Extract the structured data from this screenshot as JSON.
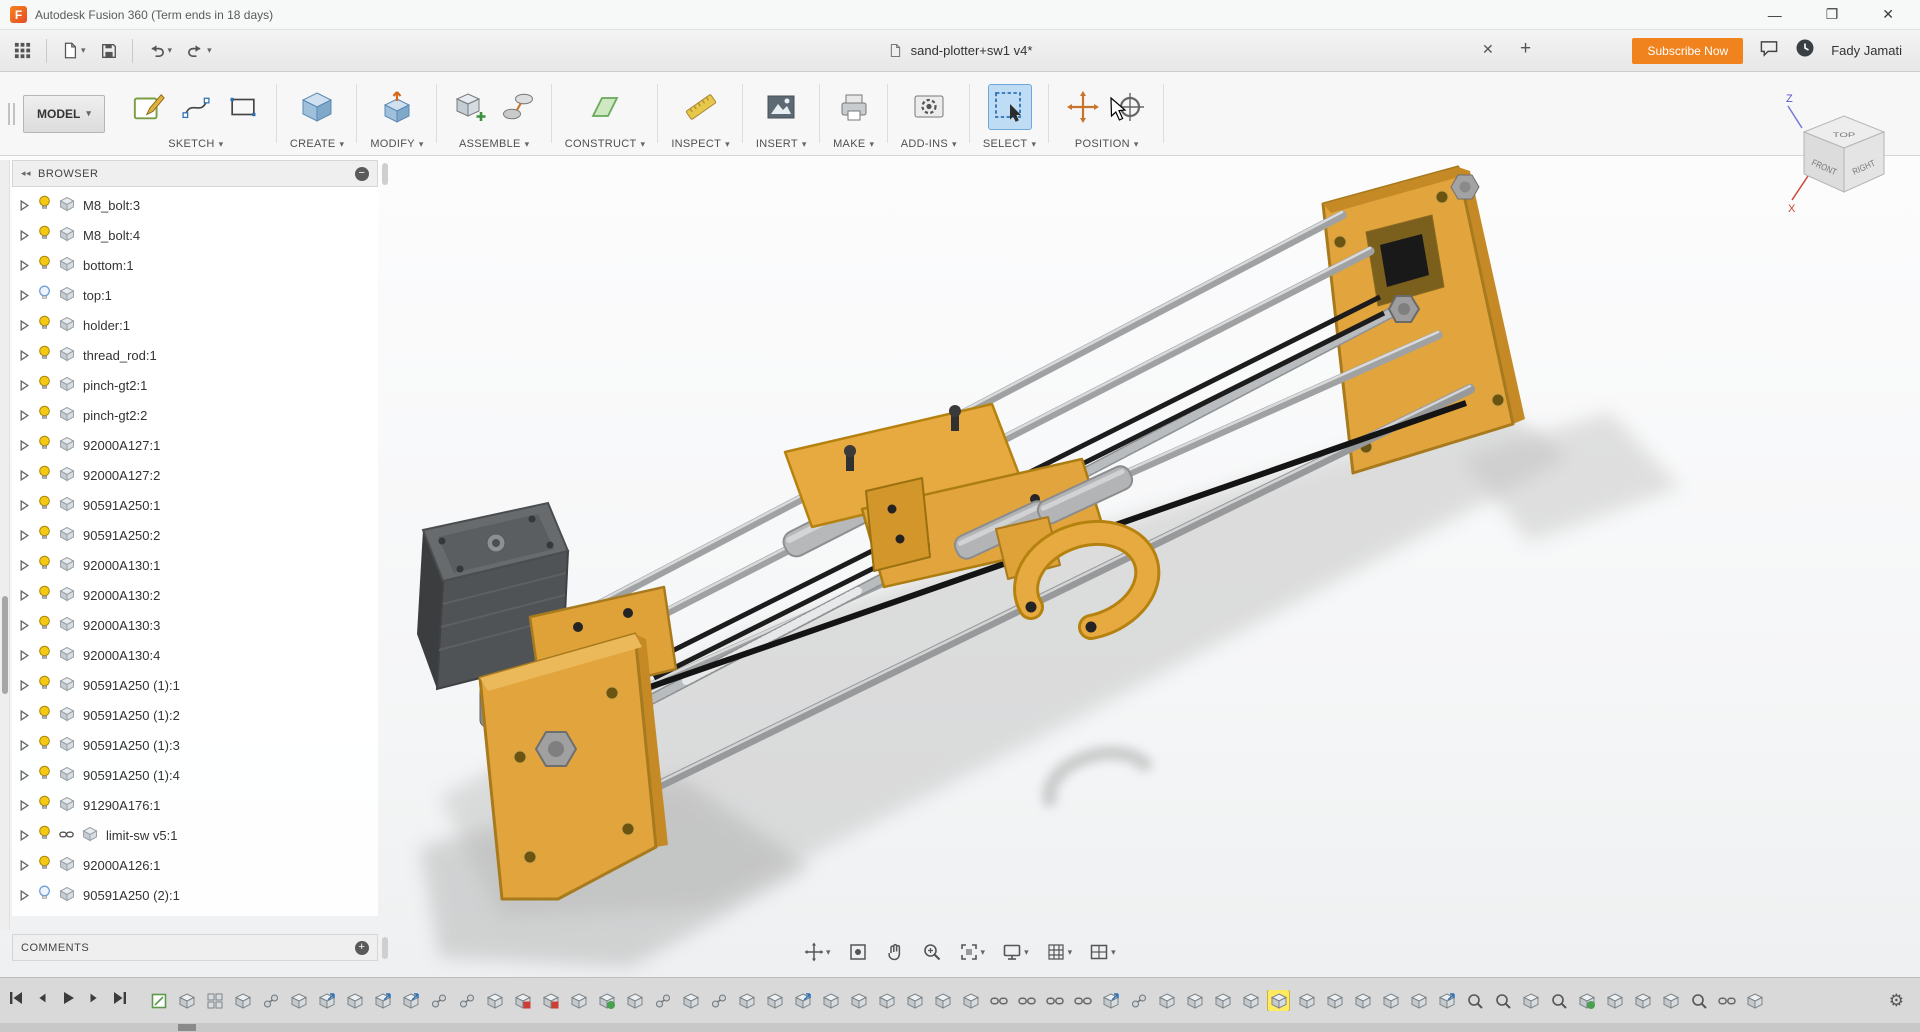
{
  "titlebar": {
    "app_title": "Autodesk Fusion 360 (Term ends in 18 days)",
    "logo_letter": "F",
    "minimize": "—",
    "maximize": "❐",
    "close": "✕"
  },
  "quickbar": {
    "document_tab": {
      "title": "sand-plotter+sw1 v4*"
    },
    "close_tab": "✕",
    "add_tab": "+",
    "subscribe_label": "Subscribe Now",
    "username": "Fady Jamati"
  },
  "ribbon": {
    "workspace_label": "MODEL",
    "groups": [
      {
        "id": "sketch",
        "label": "SKETCH",
        "icons": [
          "create-sketch-icon",
          "spline-icon",
          "rectangle-icon"
        ]
      },
      {
        "id": "create",
        "label": "CREATE",
        "icons": [
          "create-box-icon"
        ]
      },
      {
        "id": "modify",
        "label": "MODIFY",
        "icons": [
          "press-pull-icon"
        ]
      },
      {
        "id": "assemble",
        "label": "ASSEMBLE",
        "icons": [
          "new-component-icon",
          "joint-icon"
        ]
      },
      {
        "id": "construct",
        "label": "CONSTRUCT",
        "icons": [
          "construction-plane-icon"
        ]
      },
      {
        "id": "inspect",
        "label": "INSPECT",
        "icons": [
          "measure-icon"
        ]
      },
      {
        "id": "insert",
        "label": "INSERT",
        "icons": [
          "insert-canvas-icon"
        ]
      },
      {
        "id": "make",
        "label": "MAKE",
        "icons": [
          "make-3d-print-icon"
        ]
      },
      {
        "id": "addins",
        "label": "ADD-INS",
        "icons": [
          "scripts-addins-icon"
        ]
      },
      {
        "id": "select",
        "label": "SELECT",
        "icons": [
          "select-icon"
        ],
        "active": true
      },
      {
        "id": "position",
        "label": "POSITION",
        "icons": [
          "capture-position-icon",
          "joint-origin-icon"
        ]
      }
    ]
  },
  "browser": {
    "header": "BROWSER",
    "collapse_glyph": "◂◂",
    "items": [
      {
        "label": "M8_bolt:3",
        "visible": true
      },
      {
        "label": "M8_bolt:4",
        "visible": true
      },
      {
        "label": "bottom:1",
        "visible": true
      },
      {
        "label": "top:1",
        "visible": false
      },
      {
        "label": "holder:1",
        "visible": true
      },
      {
        "label": "thread_rod:1",
        "visible": true
      },
      {
        "label": "pinch-gt2:1",
        "visible": true
      },
      {
        "label": "pinch-gt2:2",
        "visible": true
      },
      {
        "label": "92000A127:1",
        "visible": true
      },
      {
        "label": "92000A127:2",
        "visible": true
      },
      {
        "label": "90591A250:1",
        "visible": true
      },
      {
        "label": "90591A250:2",
        "visible": true
      },
      {
        "label": "92000A130:1",
        "visible": true
      },
      {
        "label": "92000A130:2",
        "visible": true
      },
      {
        "label": "92000A130:3",
        "visible": true
      },
      {
        "label": "92000A130:4",
        "visible": true
      },
      {
        "label": "90591A250 (1):1",
        "visible": true
      },
      {
        "label": "90591A250 (1):2",
        "visible": true
      },
      {
        "label": "90591A250 (1):3",
        "visible": true
      },
      {
        "label": "90591A250 (1):4",
        "visible": true
      },
      {
        "label": "91290A176:1",
        "visible": true
      },
      {
        "label": "limit-sw v5:1",
        "visible": true,
        "linked": true
      },
      {
        "label": "92000A126:1",
        "visible": true
      },
      {
        "label": "90591A250 (2):1",
        "visible": false
      }
    ]
  },
  "comments": {
    "header": "COMMENTS"
  },
  "viewcube": {
    "top_label": "TOP",
    "front_label": "FRONT",
    "right_label": "RIGHT",
    "axis_x": "X",
    "axis_z": "Z"
  },
  "navbar": {
    "buttons": [
      {
        "name": "orbit-button",
        "icon": "orbit",
        "dropdown": true
      },
      {
        "name": "look-at-button",
        "icon": "lookat",
        "dropdown": false
      },
      {
        "name": "pan-button",
        "icon": "pan",
        "dropdown": false
      },
      {
        "name": "zoom-button",
        "icon": "zoom",
        "dropdown": false
      },
      {
        "name": "fit-button",
        "icon": "fit",
        "dropdown": true
      },
      {
        "name": "display-settings-button",
        "icon": "display",
        "dropdown": true
      },
      {
        "name": "grid-snaps-button",
        "icon": "grid",
        "dropdown": true
      },
      {
        "name": "viewports-button",
        "icon": "viewports",
        "dropdown": true
      }
    ]
  },
  "timeline": {
    "playback": [
      "skip-start",
      "step-back",
      "play",
      "step-forward",
      "skip-end"
    ],
    "features": [
      "sketch",
      "box",
      "grid",
      "box",
      "joint",
      "box",
      "boxarrow",
      "box",
      "boxarrow",
      "boxarrow",
      "joint",
      "joint",
      "box",
      "red",
      "red",
      "box",
      "green",
      "box",
      "joint",
      "box",
      "joint",
      "box",
      "box",
      "boxarrow",
      "box",
      "box",
      "box",
      "box",
      "box",
      "box",
      "link",
      "link",
      "link",
      "link",
      "boxarrow",
      "joint",
      "box",
      "box",
      "box",
      "box",
      "capture",
      "box",
      "box",
      "box",
      "box",
      "box",
      "boxarrow",
      "magnify",
      "magnify",
      "box",
      "magnify",
      "green",
      "box",
      "box",
      "box",
      "magnify",
      "link",
      "box"
    ],
    "gear_glyph": "⚙"
  },
  "colors": {
    "accent_orange": "#f0831e",
    "highlight_yellow": "#ffea60",
    "select_blue": "#bfdcf5",
    "model_orange": "#e2a43c"
  }
}
